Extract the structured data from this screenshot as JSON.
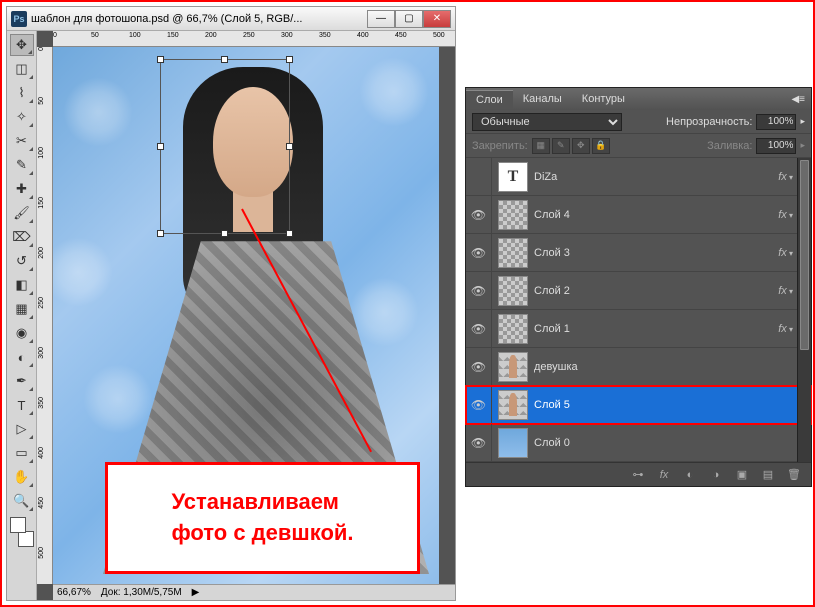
{
  "window": {
    "title": "шаблон для фотошопа.psd @ 66,7% (Слой 5, RGB/...",
    "zoom": "66,67%",
    "doc_info": "Док: 1,30M/5,75M"
  },
  "callout": {
    "line1": "Устанавливаем",
    "line2": "фото с девшкой."
  },
  "panel": {
    "tabs": [
      "Слои",
      "Каналы",
      "Контуры"
    ],
    "blend_mode": "Обычные",
    "opacity_label": "Непрозрачность:",
    "opacity_value": "100%",
    "lock_label": "Закрепить:",
    "fill_label": "Заливка:",
    "fill_value": "100%"
  },
  "layers": [
    {
      "visible": false,
      "name": "DiZa",
      "thumb": "type",
      "fx": true,
      "selected": false
    },
    {
      "visible": true,
      "name": "Слой 4",
      "thumb": "checker",
      "fx": true,
      "selected": false
    },
    {
      "visible": true,
      "name": "Слой 3",
      "thumb": "checker",
      "fx": true,
      "selected": false
    },
    {
      "visible": true,
      "name": "Слой 2",
      "thumb": "checker",
      "fx": true,
      "selected": false
    },
    {
      "visible": true,
      "name": "Слой 1",
      "thumb": "checker",
      "fx": true,
      "selected": false
    },
    {
      "visible": true,
      "name": "девушка",
      "thumb": "girl",
      "fx": false,
      "selected": false
    },
    {
      "visible": true,
      "name": "Слой 5",
      "thumb": "girl",
      "fx": false,
      "selected": true
    },
    {
      "visible": true,
      "name": "Слой 0",
      "thumb": "blue",
      "fx": false,
      "selected": false
    }
  ],
  "tools": [
    "move",
    "marquee",
    "lasso",
    "wand",
    "crop",
    "eyedropper",
    "healing",
    "brush",
    "stamp",
    "history-brush",
    "eraser",
    "gradient",
    "blur",
    "dodge",
    "pen",
    "type",
    "path-select",
    "shape",
    "hand",
    "zoom"
  ],
  "ruler_marks": [
    "0",
    "50",
    "100",
    "150",
    "200",
    "250",
    "300",
    "350",
    "400",
    "450",
    "500"
  ]
}
